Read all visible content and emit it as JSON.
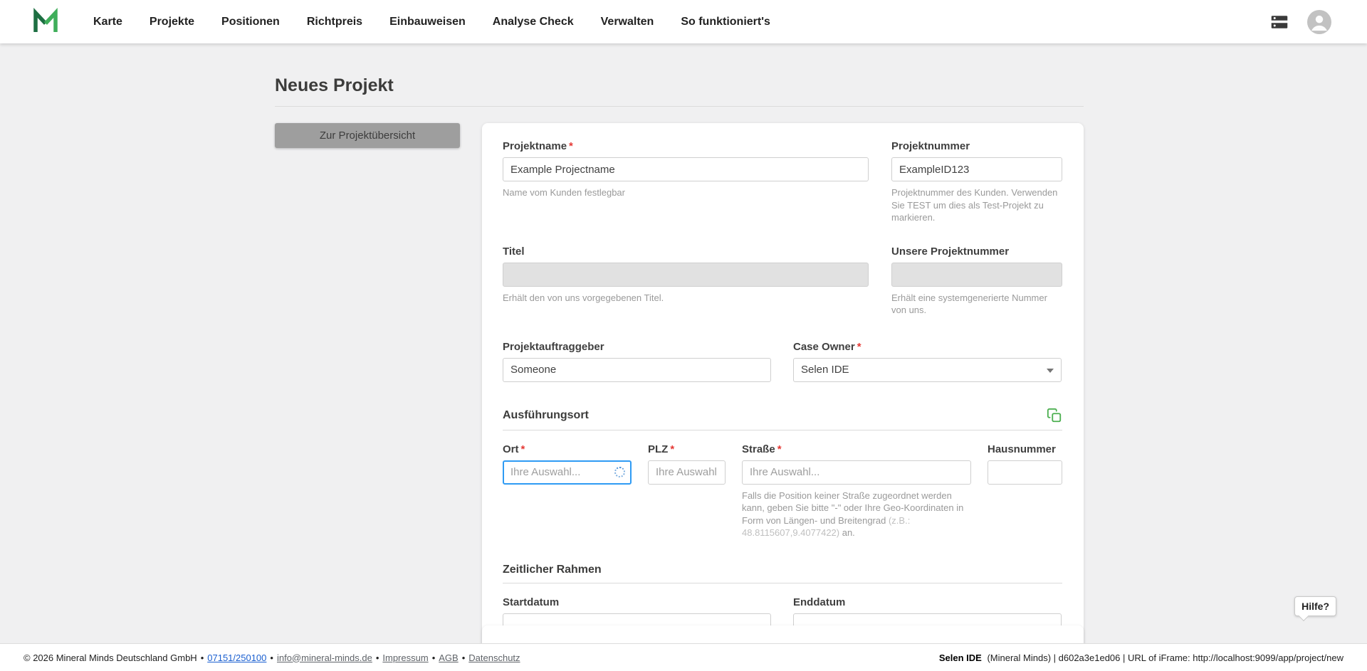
{
  "nav": {
    "items": [
      {
        "label": "Karte"
      },
      {
        "label": "Projekte"
      },
      {
        "label": "Positionen"
      },
      {
        "label": "Richtpreis"
      },
      {
        "label": "Einbauweisen"
      },
      {
        "label": "Analyse Check"
      },
      {
        "label": "Verwalten"
      },
      {
        "label": "So funktioniert's"
      }
    ]
  },
  "page": {
    "title": "Neues Projekt",
    "back_button_label": "Zur Projektübersicht",
    "help_button_label": "Hilfe?"
  },
  "form": {
    "required_marker": "*",
    "projektname": {
      "label": "Projektname",
      "value": "Example Projectname",
      "helper": "Name vom Kunden festlegbar"
    },
    "projektnummer": {
      "label": "Projektnummer",
      "value": "ExampleID123",
      "helper": "Projektnummer des Kunden. Verwenden Sie TEST um dies als Test-Projekt zu markieren."
    },
    "titel": {
      "label": "Titel",
      "value": "",
      "helper": "Erhält den von uns vorgegebenen Titel."
    },
    "unsere_projektnummer": {
      "label": "Unsere Projektnummer",
      "value": "",
      "helper": "Erhält eine systemgenerierte Nummer von uns."
    },
    "projektauftraggeber": {
      "label": "Projektauftraggeber",
      "value": "Someone"
    },
    "case_owner": {
      "label": "Case Owner",
      "value": "Selen IDE"
    },
    "section_ausfuehrungsort": "Ausführungsort",
    "section_zeitlicher_rahmen": "Zeitlicher Rahmen",
    "ort": {
      "label": "Ort",
      "placeholder": "Ihre Auswahl..."
    },
    "plz": {
      "label": "PLZ",
      "placeholder": "Ihre Auswahl."
    },
    "strasse": {
      "label": "Straße",
      "placeholder": "Ihre Auswahl...",
      "helper_main": "Falls die Position keiner Straße zugeordnet werden kann, geben Sie bitte \"-\" oder Ihre Geo-Koordinaten in Form von Längen- und Breitengrad ",
      "helper_example": "(z.B.: 48.8115607,9.4077422)",
      "helper_suffix": " an."
    },
    "hausnummer": {
      "label": "Hausnummer",
      "value": ""
    },
    "startdatum": {
      "label": "Startdatum",
      "value": ""
    },
    "enddatum": {
      "label": "Enddatum",
      "value": ""
    }
  },
  "footer": {
    "copyright": "© 2026 Mineral Minds Deutschland GmbH",
    "separator": "•",
    "phone_link": "07151/250100",
    "email_link": "info@mineral-minds.de",
    "impressum_link": "Impressum",
    "agb_link": "AGB",
    "datenschutz_link": "Datenschutz",
    "user_name": "Selen IDE",
    "session_info": "(Mineral Minds) | d602a3e1ed06 | URL of iFrame: http://localhost:9099/app/project/new"
  },
  "colors": {
    "brand_green_dark": "#1d6f42",
    "brand_green_light": "#3fae5a",
    "accent_green": "#4caf50",
    "focus_blue": "#2f9bf4",
    "required_red": "#e53935",
    "button_gray": "#9e9e9e"
  }
}
